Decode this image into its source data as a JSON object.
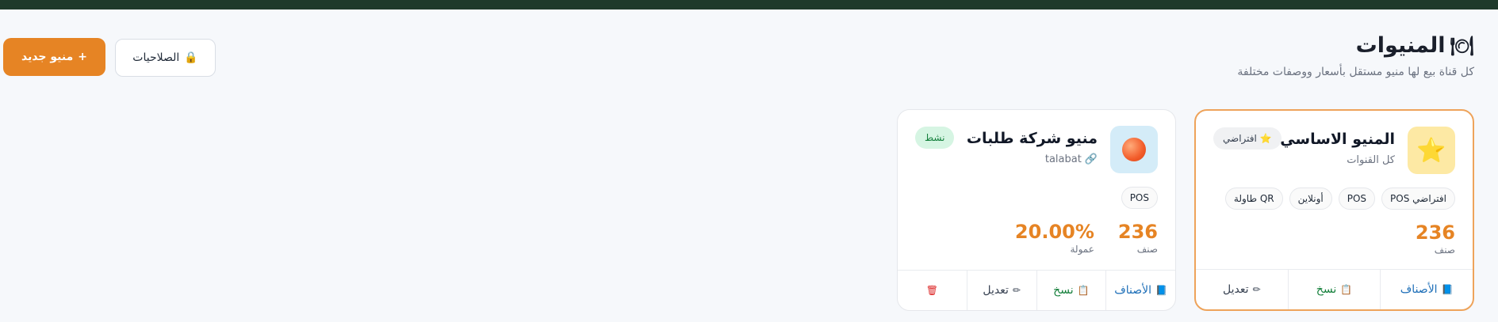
{
  "header": {
    "title_icon": "🍽",
    "title": "المنيوات",
    "subtitle": "كل قناة بيع لها منيو مستقل بأسعار ووصفات مختلفة"
  },
  "toolbar": {
    "new_menu_label": "منيو جديد",
    "new_menu_icon": "+",
    "permissions_label": "الصلاحيات",
    "permissions_icon": "🔒"
  },
  "cards": [
    {
      "title": "المنيو الاساسي",
      "subtitle": "كل القنوات",
      "logo_icon": "⭐",
      "badge_icon": "⭐",
      "badge": "افتراضي",
      "tags": [
        "POS افتراضي",
        "POS",
        "أونلاين",
        "طاولة QR"
      ],
      "stats": [
        {
          "value": "236",
          "label": "صنف"
        }
      ],
      "actions": {
        "categories": "الأصناف",
        "categories_icon": "📘",
        "copy": "نسخ",
        "copy_icon": "📋",
        "edit": "تعديل",
        "edit_icon": "✏"
      }
    },
    {
      "title": "منيو شركة طلبات",
      "subtitle": "talabat",
      "subtitle_icon": "🔗",
      "badge": "نشط",
      "tags": [
        "POS"
      ],
      "stats": [
        {
          "value": "236",
          "label": "صنف"
        },
        {
          "value": "20.00%",
          "label": "عمولة"
        }
      ],
      "actions": {
        "categories": "الأصناف",
        "categories_icon": "📘",
        "copy": "نسخ",
        "copy_icon": "📋",
        "edit": "تعديل",
        "edit_icon": "✏",
        "delete_icon": "🗑"
      }
    }
  ]
}
